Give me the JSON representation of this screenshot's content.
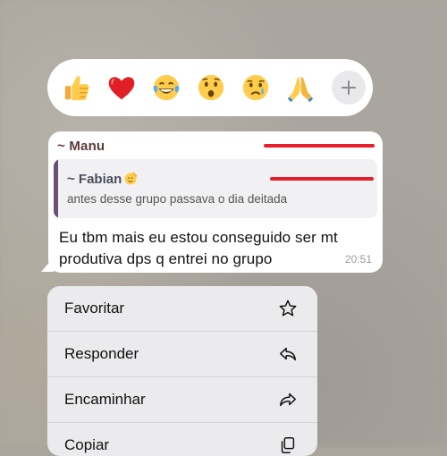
{
  "reactions": {
    "emojis": [
      "thumbs-up",
      "red-heart",
      "tears-of-joy",
      "surprised-face",
      "crying-face",
      "folded-hands"
    ],
    "more_label": "+"
  },
  "message": {
    "sender": "~ Manu",
    "quote": {
      "name": "~ Fabian",
      "text": "antes desse grupo passava o dia deitada"
    },
    "text_line1": "Eu tbm mais eu estou conseguido ser mt",
    "text_line2": "produtiva dps q entrei no grupo",
    "time": "20:51"
  },
  "menu": {
    "items": [
      {
        "label": "Favoritar",
        "icon": "star-icon"
      },
      {
        "label": "Responder",
        "icon": "reply-icon"
      },
      {
        "label": "Encaminhar",
        "icon": "forward-icon"
      },
      {
        "label": "Copiar",
        "icon": "copy-icon"
      }
    ]
  },
  "colors": {
    "redaction": "#e41e2b",
    "quote_bar": "#6b4f78"
  }
}
